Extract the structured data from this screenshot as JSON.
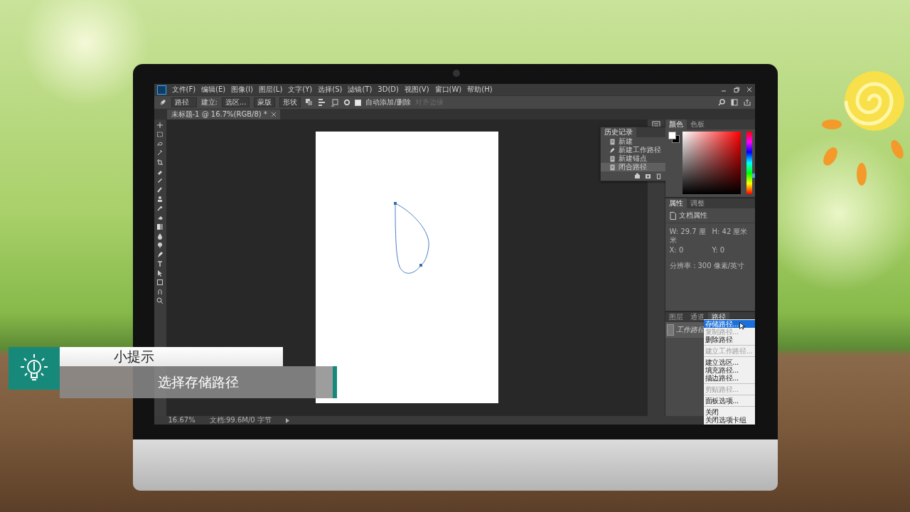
{
  "menu_bar": {
    "items": [
      "文件(F)",
      "编辑(E)",
      "图像(I)",
      "图层(L)",
      "文字(Y)",
      "选择(S)",
      "滤镜(T)",
      "3D(D)",
      "视图(V)",
      "窗口(W)",
      "帮助(H)"
    ]
  },
  "options_bar": {
    "tool_mode": "路径",
    "make_label": "建立:",
    "buttons": [
      {
        "label": "选区...",
        "disabled": false
      },
      {
        "label": "蒙版",
        "disabled": false
      },
      {
        "label": "形状",
        "disabled": false
      }
    ],
    "auto_add": {
      "label": "自动添加/删除",
      "checked": true
    },
    "align_edges": {
      "label": "对齐边缘",
      "disabled": true
    }
  },
  "document_tab": {
    "title": "未标题-1 @ 16.7%(RGB/8) *"
  },
  "history_panel": {
    "title": "历史记录",
    "items": [
      {
        "label": "新建",
        "kind": "document",
        "selected": false
      },
      {
        "label": "新建工作路径",
        "kind": "pen",
        "selected": false
      },
      {
        "label": "新建锚点",
        "kind": "document",
        "selected": false
      },
      {
        "label": "闭合路径",
        "kind": "document",
        "selected": true
      }
    ]
  },
  "color_panel": {
    "tabs": [
      {
        "label": "颜色",
        "selected": true
      },
      {
        "label": "色板",
        "selected": false
      }
    ],
    "hue_slider": {
      "level": 0.29
    }
  },
  "properties_panel": {
    "tabs": [
      {
        "label": "属性",
        "selected": true
      },
      {
        "label": "调整",
        "selected": false
      }
    ],
    "heading": "文档属性",
    "fields": [
      {
        "label": "W:",
        "value": "29.7 厘米"
      },
      {
        "label": "H:",
        "value": "42 厘米"
      },
      {
        "label": "X:",
        "value": "0"
      },
      {
        "label": "Y:",
        "value": "0"
      }
    ],
    "resolution": "分辨率：300 像素/英寸"
  },
  "paths_panel": {
    "tabs": [
      {
        "label": "图层",
        "selected": false
      },
      {
        "label": "通道",
        "selected": false
      },
      {
        "label": "路径",
        "selected": true
      }
    ],
    "items": [
      {
        "label": "工作路径",
        "selected": true
      }
    ]
  },
  "context_menu": {
    "groups": [
      [
        {
          "label": "存储路径...",
          "selected": true,
          "disabled": false
        },
        {
          "label": "复制路径...",
          "selected": false,
          "disabled": true
        },
        {
          "label": "删除路径",
          "selected": false,
          "disabled": false
        }
      ],
      [
        {
          "label": "建立工作路径...",
          "selected": false,
          "disabled": true
        }
      ],
      [
        {
          "label": "建立选区...",
          "selected": false,
          "disabled": false
        },
        {
          "label": "填充路径...",
          "selected": false,
          "disabled": false
        },
        {
          "label": "描边路径...",
          "selected": false,
          "disabled": false
        }
      ],
      [
        {
          "label": "剪贴路径...",
          "selected": false,
          "disabled": true
        }
      ],
      [
        {
          "label": "面板选项...",
          "selected": false,
          "disabled": false
        }
      ],
      [
        {
          "label": "关闭",
          "selected": false,
          "disabled": false
        },
        {
          "label": "关闭选项卡组",
          "selected": false,
          "disabled": false
        }
      ]
    ]
  },
  "status_bar": {
    "zoom": "16.67%",
    "doc_info": "文档:99.6M/0 字节"
  },
  "tip": {
    "title": "小提示",
    "text": "选择存储路径"
  }
}
